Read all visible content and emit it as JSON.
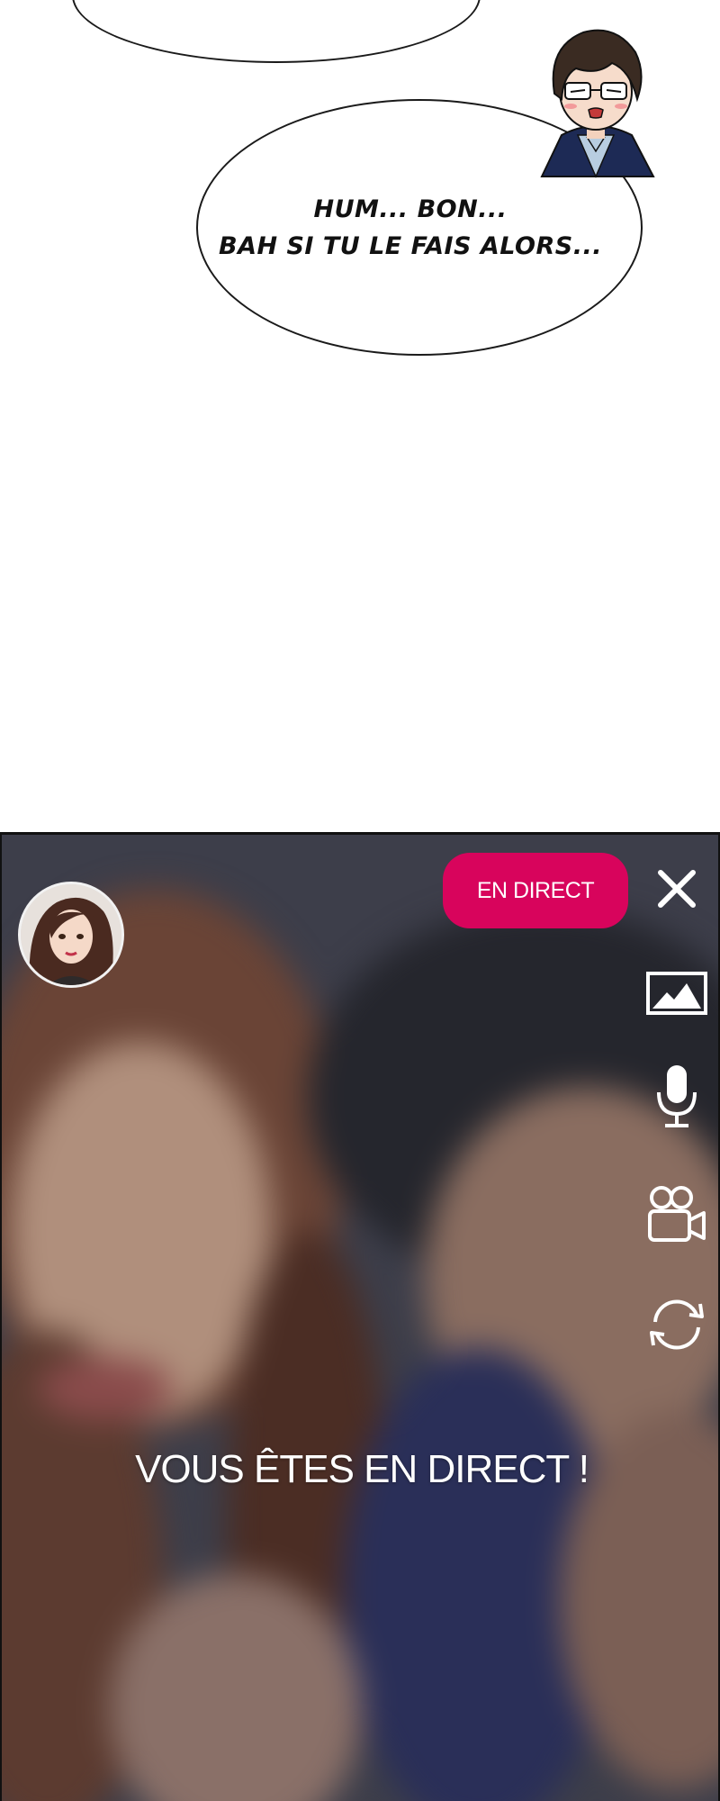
{
  "speech": {
    "lines": [
      "HUM... BON...",
      "BAH SI TU LE FAIS ALORS..."
    ]
  },
  "live": {
    "badge_label": "EN DIRECT",
    "message": "VOUS ÊTES EN DIRECT !",
    "accent_color": "#d8045c"
  },
  "controls": {
    "icons": [
      "close-icon",
      "image-icon",
      "microphone-icon",
      "video-camera-icon",
      "switch-camera-icon"
    ]
  }
}
